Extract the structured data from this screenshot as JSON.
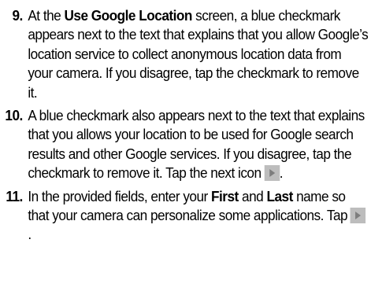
{
  "steps": [
    {
      "number": "9.",
      "text_a": "At the ",
      "bold_a": "Use Google Location",
      "text_b": " screen, a blue checkmark appears next to the text that explains that you allow Google’s location service to collect anonymous location data from your camera. If you disagree, tap the checkmark to remove it."
    },
    {
      "number": "10.",
      "text_a": "A blue checkmark also appears next to the text that explains that you allows your location to be used for Google search results and other Google services. If you disagree, tap the checkmark to remove it. Tap the next icon",
      "text_b": "."
    },
    {
      "number": "11.",
      "text_a": "In the provided fields, enter your ",
      "bold_a": "First",
      "text_b": " and ",
      "bold_b": "Last",
      "text_c": " name so that your camera can personalize some applications. Tap",
      "text_d": "."
    }
  ],
  "icons": {
    "next": "play-arrow-icon",
    "next_bg": "#bdbdbd",
    "next_fg": "#7d7d7d"
  }
}
